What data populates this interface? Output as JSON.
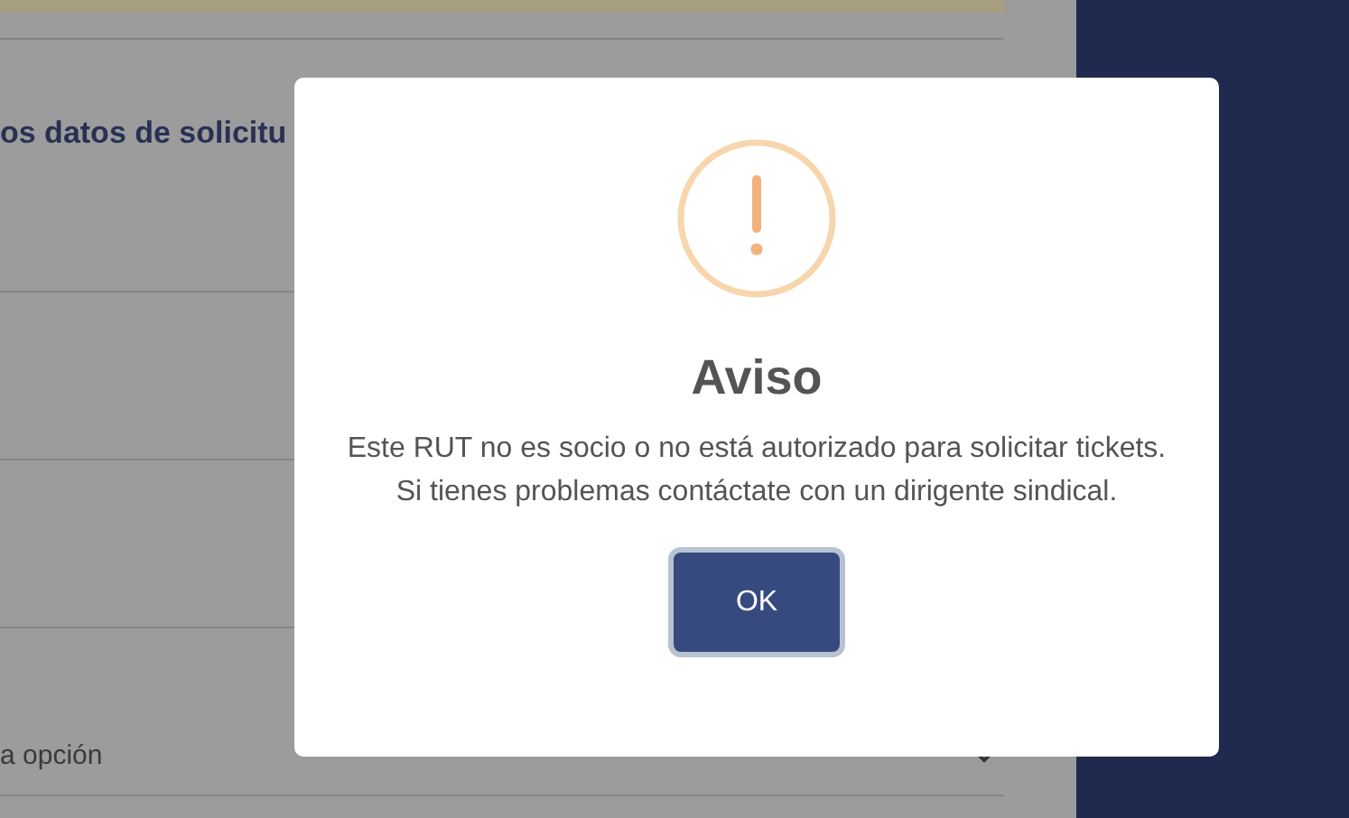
{
  "form": {
    "heading": "os datos de solicitu",
    "select": {
      "value": "a opción"
    }
  },
  "dialog": {
    "title": "Aviso",
    "message": "Este RUT no es socio o no está autorizado para solicitar tickets. Si tienes problemas contáctate con un dirigente sindical.",
    "buttons": [
      {
        "label": "OK",
        "focused": true
      }
    ]
  }
}
